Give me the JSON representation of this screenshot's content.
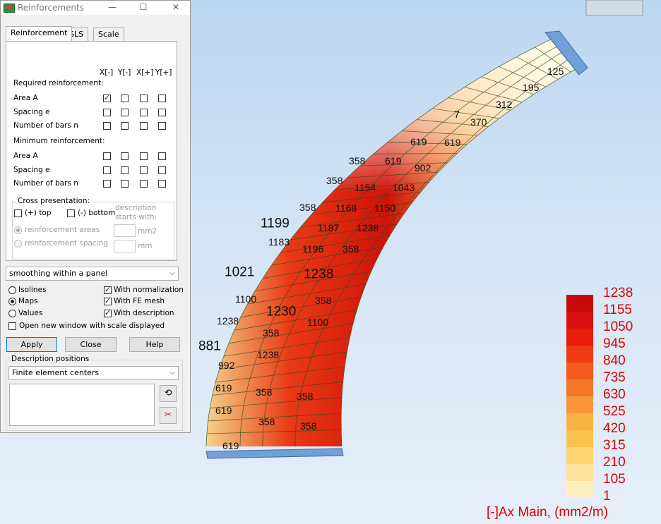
{
  "dialog": {
    "title": "Reinforcements",
    "tabs": [
      "Reinforcement",
      "SLS",
      "Scale"
    ],
    "columns": [
      "X[-]",
      "Y[-]",
      "X[+]",
      "Y[+]"
    ],
    "required_heading": "Required reinforcement:",
    "required_rows": [
      {
        "label": "Area A",
        "checks": [
          true,
          false,
          false,
          false
        ]
      },
      {
        "label": "Spacing e",
        "checks": [
          false,
          false,
          false,
          false
        ]
      },
      {
        "label": "Number of bars n",
        "checks": [
          false,
          false,
          false,
          false
        ]
      }
    ],
    "minimum_heading": "Minimum reinforcement:",
    "minimum_rows": [
      {
        "label": "Area A",
        "checks": [
          false,
          false,
          false,
          false
        ]
      },
      {
        "label": "Spacing e",
        "checks": [
          false,
          false,
          false,
          false
        ]
      },
      {
        "label": "Number of bars n",
        "checks": [
          false,
          false,
          false,
          false
        ]
      }
    ],
    "cross": {
      "legend": "Cross presentation:",
      "top_label": "(+) top",
      "bottom_label": "(-) bottom",
      "desc_line1": "description",
      "desc_line2": "starts with:",
      "radio_areas": "reinforcement areas",
      "radio_spacing": "reinforcement spacing",
      "unit_area": "mm2",
      "unit_spacing": "mm"
    },
    "smoothing": "smoothing within a panel",
    "display": {
      "isolines": "Isolines",
      "maps": "Maps",
      "values": "Values",
      "selected": "Maps",
      "with_normalization": "With normalization",
      "with_fe_mesh": "With FE mesh",
      "with_description": "With description",
      "open_new_window": "Open new window with scale displayed"
    },
    "buttons": {
      "apply": "Apply",
      "close": "Close",
      "help": "Help"
    },
    "description_positions": {
      "legend": "Description positions",
      "value": "Finite element centers"
    }
  },
  "model": {
    "labels_small": [
      "125",
      "195",
      "312",
      "7",
      "370",
      "619",
      "619",
      "619",
      "902",
      "358",
      "1043",
      "358",
      "1154",
      "358",
      "1168",
      "1150",
      "1187",
      "1238",
      "1183",
      "1196",
      "358",
      "1100",
      "358",
      "1238",
      "1100",
      "358",
      "1238",
      "992",
      "619",
      "358",
      "358",
      "619",
      "358",
      "358",
      "619"
    ],
    "labels_large": [
      "1199",
      "1021",
      "1238",
      "1230",
      "881"
    ]
  },
  "legend": {
    "values": [
      "1238",
      "1155",
      "1050",
      "945",
      "840",
      "735",
      "630",
      "525",
      "420",
      "315",
      "210",
      "105",
      "1"
    ],
    "colors": [
      "#c80a0a",
      "#dc1010",
      "#e81c0a",
      "#f03a14",
      "#f45a1c",
      "#f57828",
      "#f89638",
      "#fab244",
      "#fcc24e",
      "#fdd574",
      "#fee39c",
      "#fff0c2",
      "#fffbe4"
    ],
    "title": "[-]Ax Main, (mm2/m)"
  }
}
